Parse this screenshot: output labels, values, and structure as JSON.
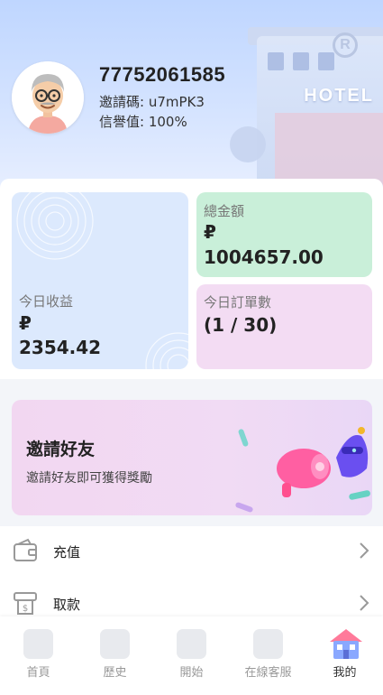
{
  "user": {
    "username": "77752061585",
    "invite_label": "邀請碼:",
    "invite_code": "u7mPK3",
    "credit_label": "信譽值:",
    "credit_value": "100%"
  },
  "header": {
    "hotel_sign": "HOTEL",
    "hotel_logo": "R"
  },
  "stats": {
    "today_income": {
      "label": "今日收益",
      "currency": "₽",
      "value": "2354.42"
    },
    "total_balance": {
      "label": "總金額",
      "currency": "₽",
      "value": "1004657.00"
    },
    "today_orders": {
      "label": "今日訂單數",
      "value": "(1 / 30)"
    }
  },
  "invite_banner": {
    "title": "邀請好友",
    "subtitle": "邀請好友即可獲得獎勵"
  },
  "menu": [
    {
      "label": "充值",
      "icon": "wallet-icon"
    },
    {
      "label": "取款",
      "icon": "withdraw-icon"
    }
  ],
  "nav": [
    {
      "label": "首頁",
      "icon": "home-icon"
    },
    {
      "label": "歷史",
      "icon": "history-icon"
    },
    {
      "label": "開始",
      "icon": "start-icon"
    },
    {
      "label": "在線客服",
      "icon": "support-icon"
    },
    {
      "label": "我的",
      "icon": "profile-icon",
      "active": true
    }
  ],
  "colors": {
    "tile_today": "#dce9fd",
    "tile_total": "#c9efd9",
    "tile_orders": "#f3dcf3",
    "invite_bg": "#f2d7f1"
  }
}
